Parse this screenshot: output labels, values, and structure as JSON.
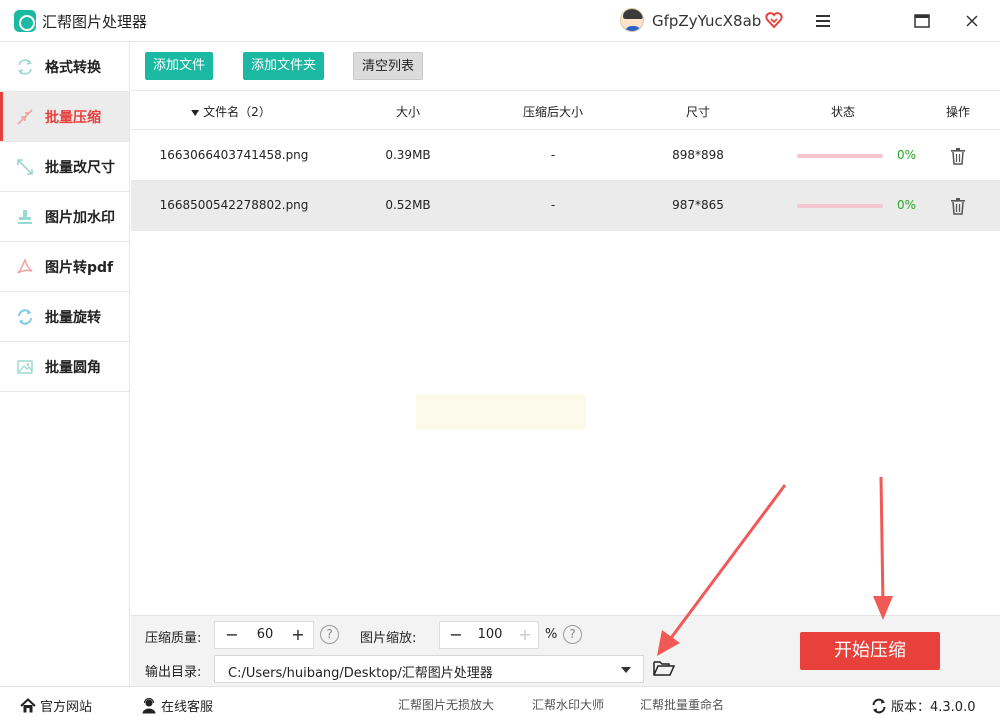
{
  "window": {
    "title": "汇帮图片处理器",
    "username": "GfpZyYucX8ab"
  },
  "sidebar": {
    "items": [
      {
        "label": "格式转换",
        "icon": "format-convert-icon",
        "active": false
      },
      {
        "label": "批量压缩",
        "icon": "compress-icon",
        "active": true
      },
      {
        "label": "批量改尺寸",
        "icon": "resize-icon",
        "active": false
      },
      {
        "label": "图片加水印",
        "icon": "watermark-icon",
        "active": false
      },
      {
        "label": "图片转pdf",
        "icon": "pdf-icon",
        "active": false
      },
      {
        "label": "批量旋转",
        "icon": "rotate-icon",
        "active": false
      },
      {
        "label": "批量圆角",
        "icon": "round-corner-icon",
        "active": false
      }
    ]
  },
  "toolbar": {
    "add_file": "添加文件",
    "add_folder": "添加文件夹",
    "clear_list": "清空列表"
  },
  "table": {
    "headers": {
      "filename": "文件名（2）",
      "size": "大小",
      "compressed_size": "压缩后大小",
      "dimensions": "尺寸",
      "status": "状态",
      "actions": "操作"
    },
    "rows": [
      {
        "filename": "1663066403741458.png",
        "size": "0.39MB",
        "compressed": "-",
        "dimensions": "898*898",
        "progress": "0%"
      },
      {
        "filename": "1668500542278802.png",
        "size": "0.52MB",
        "compressed": "-",
        "dimensions": "987*865",
        "progress": "0%"
      }
    ]
  },
  "settings": {
    "quality_label": "压缩质量:",
    "quality_value": "60",
    "scale_label": "图片缩放:",
    "scale_value": "100",
    "scale_unit": "%",
    "help_glyph": "?",
    "output_label": "输出目录:",
    "output_path": "C:/Users/huibang/Desktop/汇帮图片处理器",
    "minus_glyph": "−",
    "plus_glyph": "+"
  },
  "actions": {
    "start": "开始压缩"
  },
  "footer": {
    "website": "官方网站",
    "support": "在线客服",
    "links": [
      "汇帮图片无损放大",
      "汇帮水印大师",
      "汇帮批量重命名"
    ],
    "version_label": "版本：4.3.0.0"
  },
  "colors": {
    "accent": "#1cb9a2",
    "active": "#e8413b",
    "progress_text": "#2aa52a"
  }
}
